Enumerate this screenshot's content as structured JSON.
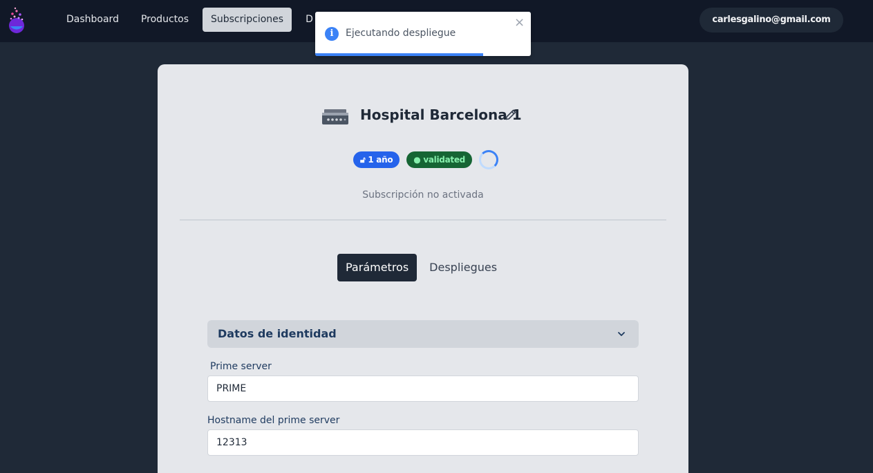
{
  "nav": {
    "items": [
      {
        "label": "Dashboard",
        "active": false
      },
      {
        "label": "Productos",
        "active": false
      },
      {
        "label": "Subscripciones",
        "active": true
      },
      {
        "label": "D",
        "active": false
      }
    ],
    "user_email": "carlesgalino@gmail.com"
  },
  "toast": {
    "message": "Ejecutando despliegue",
    "icon": "info-icon",
    "progress": 0.78,
    "color": "#3b82f6"
  },
  "subscription": {
    "device_icon": "server-icon",
    "title": "Hospital Barcelona 1",
    "plan_badge": "1 año",
    "status_badge": "validated",
    "status_text": "Subscripción no activada"
  },
  "tabs": [
    {
      "label": "Parámetros",
      "active": true
    },
    {
      "label": "Despliegues",
      "active": false
    }
  ],
  "section": {
    "title": "Datos de identidad"
  },
  "fields": [
    {
      "label": "Prime server",
      "value": "PRIME"
    },
    {
      "label": "Hostname del prime server",
      "value": "12313"
    }
  ],
  "colors": {
    "accent": "#2563eb",
    "status_green": "#166534",
    "dark": "#1f2937"
  }
}
